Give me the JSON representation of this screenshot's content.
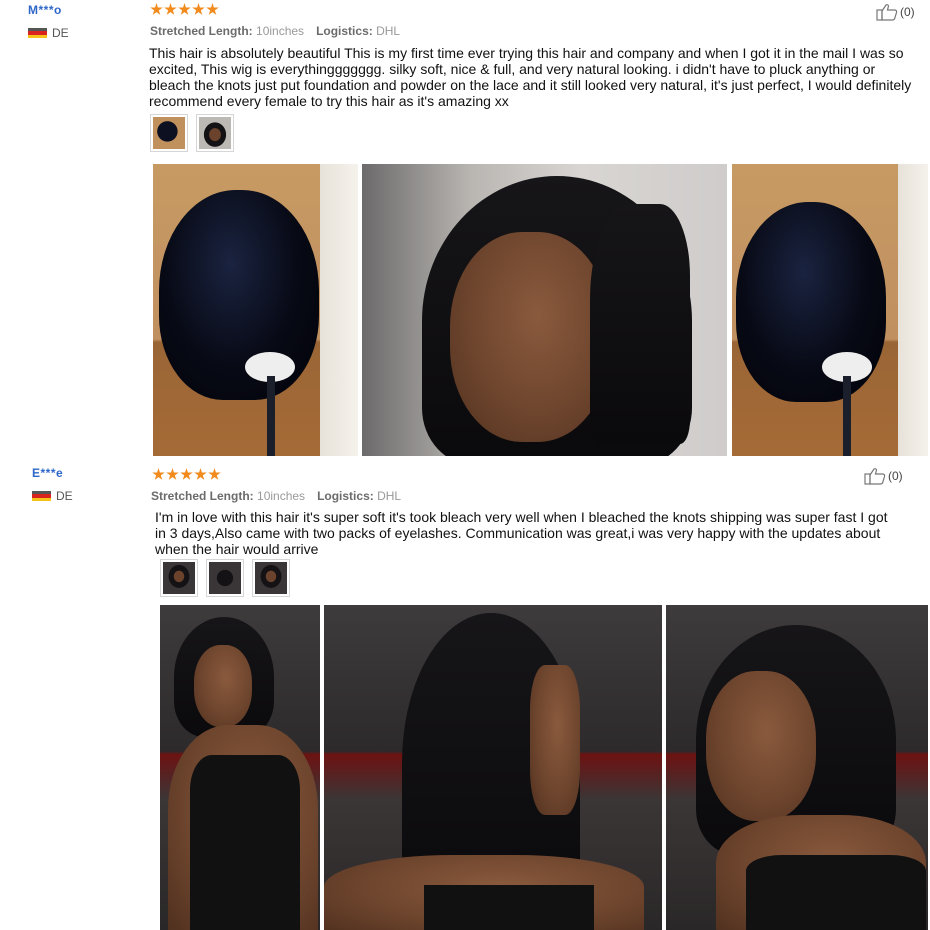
{
  "reviews": [
    {
      "user": "M***o",
      "country": "DE",
      "rating": 5,
      "stretched_label": "Stretched Length:",
      "stretched_value": "10inches",
      "logistics_label": "Logistics:",
      "logistics_value": "DHL",
      "helpful_count": "(0)",
      "text": "This hair is absolutely beautiful This is my first time ever trying this hair and company and when I got it in the mail I was so excited, This wig is everythinggggggg. silky soft, nice & full, and very natural looking. i didn't have to pluck anything or bleach the knots just put foundation and powder on the lace and it still looked very natural, it's just perfect, I would definitely recommend every female to try this hair as it's amazing xx"
    },
    {
      "user": "E***e",
      "country": "DE",
      "rating": 5,
      "stretched_label": "Stretched Length:",
      "stretched_value": "10inches",
      "logistics_label": "Logistics:",
      "logistics_value": "DHL",
      "helpful_count": "(0)",
      "text": "I'm in love with this hair it's super soft it's took bleach very well when I bleached the knots shipping was super fast I got in 3 days,Also came with two packs of eyelashes. Communication was great,i was very happy with the updates about when the hair would arrive"
    }
  ],
  "icons": {
    "star": "star-icon",
    "thumb": "thumbs-up-icon",
    "flag": "germany-flag-icon"
  },
  "colors": {
    "username": "#2f67c8",
    "star": "#f28b1e",
    "meta_label": "#6b6b6b"
  }
}
